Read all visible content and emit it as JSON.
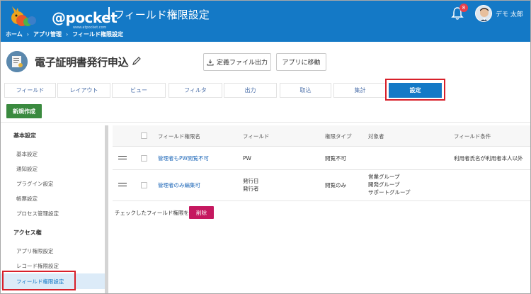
{
  "header": {
    "logo_text": "@pocket",
    "logo_sub": "www.atpocket.com",
    "page_title": "フィールド権限設定",
    "breadcrumb": [
      "ホーム",
      "アプリ管理",
      "フィールド権限設定"
    ],
    "breadcrumb_sep": "›",
    "notification_count": "8",
    "user_name": "デモ 太郎"
  },
  "app": {
    "title": "電子証明書発行申込",
    "export_label": "定義ファイル出力",
    "goto_label": "アプリに移動"
  },
  "tabs": [
    {
      "label": "フィールド",
      "active": false
    },
    {
      "label": "レイアウト",
      "active": false
    },
    {
      "label": "ビュー",
      "active": false
    },
    {
      "label": "フィルタ",
      "active": false
    },
    {
      "label": "出力",
      "active": false
    },
    {
      "label": "取込",
      "active": false
    },
    {
      "label": "集計",
      "active": false
    },
    {
      "label": "設定",
      "active": true
    }
  ],
  "new_button": "新規作成",
  "sidebar": {
    "sections": [
      {
        "title": "基本設定",
        "items": [
          "基本設定",
          "通知設定",
          "プラグイン設定",
          "帳票設定",
          "プロセス管理設定"
        ]
      },
      {
        "title": "アクセス権",
        "items": [
          "アプリ権限設定",
          "レコード権限設定",
          "フィールド権限設定"
        ]
      }
    ],
    "active_item": "フィールド権限設定"
  },
  "table": {
    "columns": [
      "フィールド権限名",
      "フィールド",
      "権限タイプ",
      "対象者",
      "フィールド条件"
    ],
    "rows": [
      {
        "name": "管理者もPW閲覧不可",
        "fields": [
          "PW"
        ],
        "type": "閲覧不可",
        "targets": [],
        "condition": "利用者氏名が利用者本人以外"
      },
      {
        "name": "管理者のみ編集可",
        "fields": [
          "発行日",
          "発行者"
        ],
        "type": "閲覧のみ",
        "targets": [
          "営業グループ",
          "開発グループ",
          "サポートグループ"
        ],
        "condition": ""
      }
    ],
    "footer_text": "チェックしたフィールド権限を",
    "delete_label": "削除"
  },
  "colors": {
    "brand": "#1479c6",
    "new_button": "#3a8a3f",
    "delete_button": "#c5185f",
    "highlight": "#d8202a"
  }
}
